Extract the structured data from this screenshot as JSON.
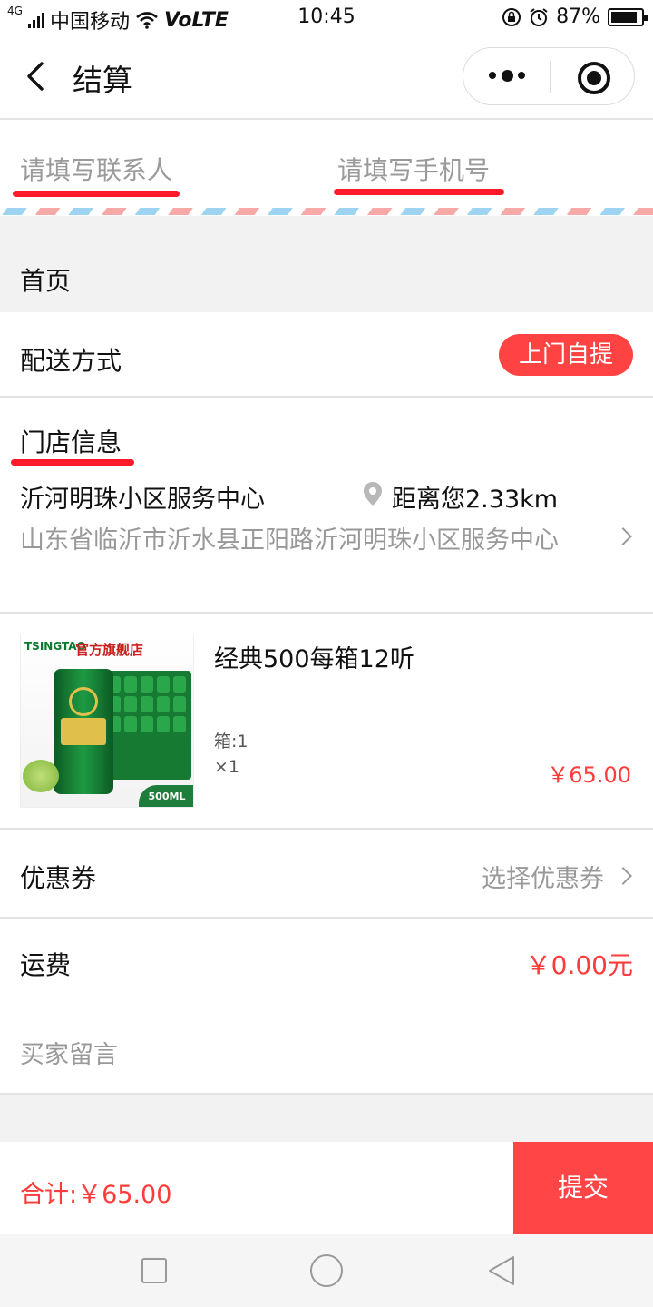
{
  "status_bar": {
    "network": "4G",
    "carrier": "中国移动",
    "volte": "VoLTE",
    "time": "10:45",
    "battery": "87%",
    "battery_level": 0.87
  },
  "nav": {
    "title": "结算"
  },
  "contact": {
    "name_placeholder": "请填写联系人",
    "phone_placeholder": "请填写手机号"
  },
  "home_label": "首页",
  "delivery": {
    "label": "配送方式",
    "method": "上门自提"
  },
  "store": {
    "section_label": "门店信息",
    "name": "沂河明珠小区服务中心",
    "distance": "距离您2.33km",
    "address": "山东省临沂市沂水县正阳路沂河明珠小区服务中心"
  },
  "product": {
    "image_brand": "TSINGTAO",
    "image_flag": "官方旗舰店",
    "image_volume": "500ML",
    "title": "经典500每箱12听",
    "spec": "箱:1",
    "qty": "×1",
    "price": "￥65.00"
  },
  "coupon": {
    "label": "优惠券",
    "action": "选择优惠券"
  },
  "shipping": {
    "label": "运费",
    "value": "￥0.00元"
  },
  "message": {
    "placeholder": "买家留言"
  },
  "footer": {
    "total": "合计:￥65.00",
    "submit": "提交"
  },
  "colors": {
    "accent": "#ff4545",
    "underline": "#ff1a2a",
    "muted": "#999999"
  }
}
